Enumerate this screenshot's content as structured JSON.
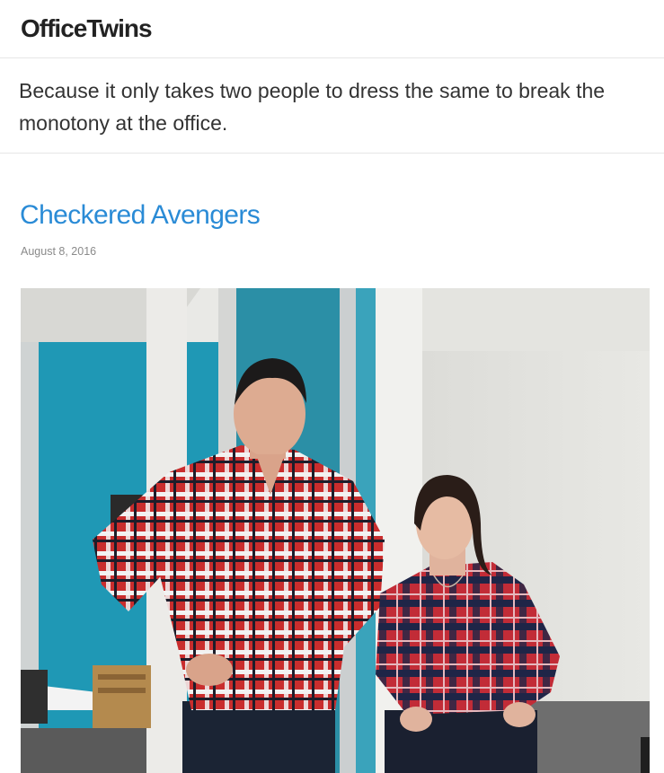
{
  "site": {
    "title": "OfficeTwins"
  },
  "tagline": "Because it only takes two people to dress the same to break the monotony at the office.",
  "post": {
    "title": "Checkered Avengers",
    "date": "August 8, 2016"
  },
  "colors": {
    "link": "#2a8bd6",
    "divider": "#e6e6e6",
    "text": "#333333"
  }
}
